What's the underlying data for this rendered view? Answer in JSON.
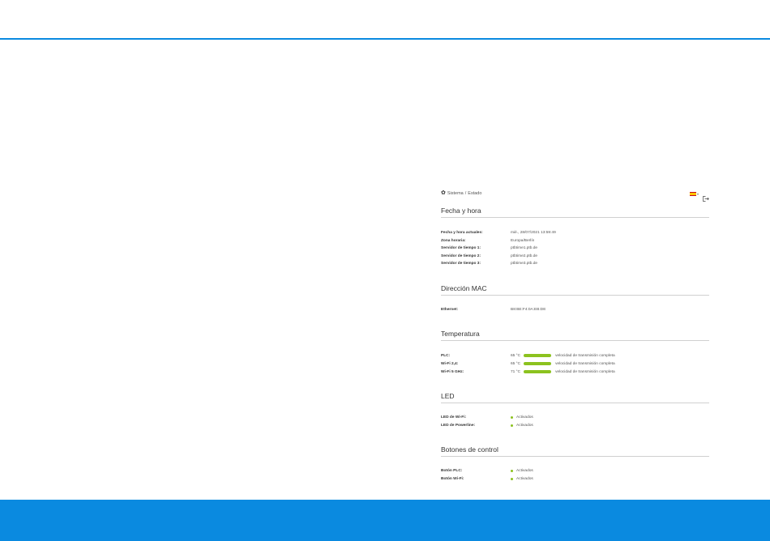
{
  "breadcrumb": {
    "section": "Sistema",
    "separator": "/",
    "page": "Estado"
  },
  "colors": {
    "accent": "#0a8ae0",
    "status_ok": "#8cc21f",
    "flag": "es"
  },
  "icons": {
    "settings": "gear-icon",
    "language": "spain-flag-icon",
    "logout": "logout-icon"
  },
  "sections": {
    "datetime": {
      "title": "Fecha y hora",
      "rows": [
        {
          "label": "Fecha y hora actuales:",
          "value": "mié., 28/07/2021 13:59:49"
        },
        {
          "label": "Zona horaria:",
          "value": "Europa/Berlín"
        },
        {
          "label": "Servidor de tiempo 1:",
          "value": "ptbtime1.ptb.de"
        },
        {
          "label": "Servidor de tiempo 2:",
          "value": "ptbtime2.ptb.de"
        },
        {
          "label": "Servidor de tiempo 3:",
          "value": "ptbtime3.ptb.de"
        }
      ]
    },
    "mac": {
      "title": "Dirección MAC",
      "rows": [
        {
          "label": "Ethernet:",
          "value": "B8:BE:F4:0A:EB:DE"
        }
      ]
    },
    "temperature": {
      "title": "Temperatura",
      "rows": [
        {
          "label": "PLC:",
          "value": "65 °C",
          "status": "velocidad de transmisión completa",
          "level": 1.0
        },
        {
          "label": "Wi-Fi 2,4:",
          "value": "65 °C",
          "status": "velocidad de transmisión completa",
          "level": 1.0
        },
        {
          "label": "Wi-Fi 5 GHz:",
          "value": "71 °C",
          "status": "velocidad de transmisión completa",
          "level": 1.0
        }
      ]
    },
    "led": {
      "title": "LED",
      "rows": [
        {
          "label": "LED de Wi-Fi:",
          "value": "Activados"
        },
        {
          "label": "LED de Powerline:",
          "value": "Activados"
        }
      ]
    },
    "buttons": {
      "title": "Botones de control",
      "rows": [
        {
          "label": "Botón PLC:",
          "value": "Activados"
        },
        {
          "label": "Botón Wi-Fi:",
          "value": "Activados"
        }
      ]
    }
  }
}
